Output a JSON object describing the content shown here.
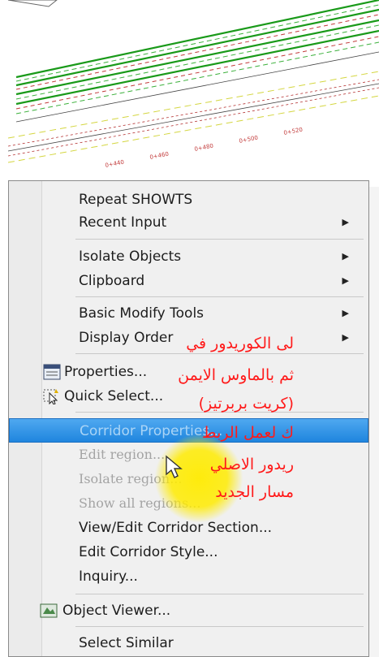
{
  "drawing": {
    "station_labels": [
      "0+440",
      "0+460",
      "0+480",
      "0+500",
      "0+520"
    ]
  },
  "menu": {
    "items": [
      {
        "label": "Repeat SHOWTS",
        "arrow": ""
      },
      {
        "label": "Recent Input",
        "arrow": "▶"
      },
      {
        "label": "Isolate Objects",
        "arrow": "▶"
      },
      {
        "label": "Clipboard",
        "arrow": "▶"
      },
      {
        "label": "Basic Modify Tools",
        "arrow": "▶"
      },
      {
        "label": "Display Order",
        "arrow": "▶"
      },
      {
        "label": "Properties...",
        "icon": "properties-icon"
      },
      {
        "label": "Quick Select...",
        "icon": "quick-select-icon"
      },
      {
        "label": "Corridor Properties...",
        "highlighted": true
      },
      {
        "label": "Edit region...",
        "disabled": true
      },
      {
        "label": "Isolate region...",
        "disabled": true
      },
      {
        "label": "Show all regions...",
        "disabled": true
      },
      {
        "label": "View/Edit Corridor Section..."
      },
      {
        "label": "Edit Corridor Style..."
      },
      {
        "label": "Inquiry..."
      },
      {
        "label": "Object Viewer...",
        "icon": "object-viewer-icon"
      },
      {
        "label": "Select Similar"
      }
    ]
  },
  "annotation": {
    "lines": [
      "لى الكوريدور في",
      "ثم بالماوس الايمن",
      "(كريت بربرتيز)",
      "ك لعمل الربط",
      "ريدور الاصلي",
      "مسار الجديد"
    ],
    "color": "#ff1a1a"
  },
  "colors": {
    "highlight": "#2a8fe3",
    "cursor_glow": "#ffeb00",
    "corridor_green": "#1a9a1a"
  }
}
